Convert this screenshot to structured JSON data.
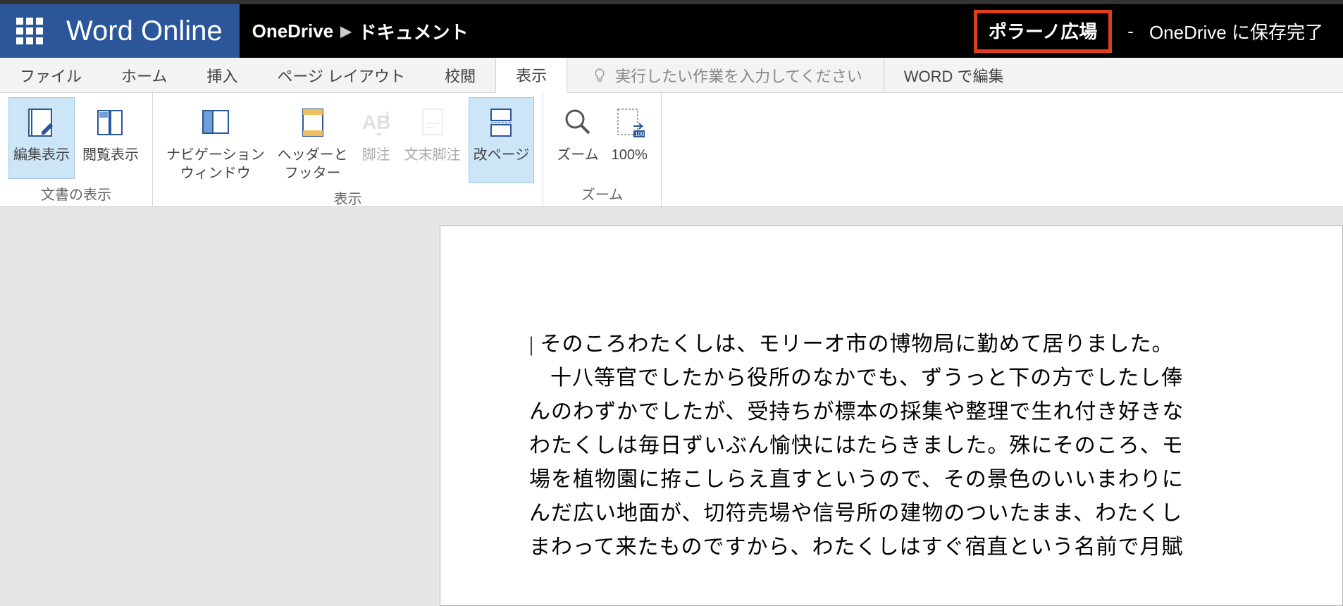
{
  "brand": {
    "title": "Word Online"
  },
  "breadcrumb": {
    "root": "OneDrive",
    "folder": "ドキュメント"
  },
  "document": {
    "name": "ポラーノ広場",
    "saved_status": "OneDrive に保存完了",
    "dash": "-"
  },
  "tabs": {
    "file": "ファイル",
    "home": "ホーム",
    "insert": "挿入",
    "layout": "ページ レイアウト",
    "review": "校閲",
    "view": "表示"
  },
  "tell_me": {
    "placeholder": "実行したい作業を入力してください"
  },
  "edit_in_word": "WORD で編集",
  "ribbon": {
    "edit_view": "編集表示",
    "reading_view": "閲覧表示",
    "nav_pane": "ナビゲーション\nウィンドウ",
    "header_footer": "ヘッダーと\nフッター",
    "footnotes": "脚注",
    "endnotes": "文末脚注",
    "page_breaks": "改ページ",
    "zoom": "ズーム",
    "zoom100": "100%",
    "group_views": "文書の表示",
    "group_show": "表示",
    "group_zoom": "ズーム"
  },
  "body": {
    "line1": " そのころわたくしは、モリーオ市の博物局に勤めて居りました。",
    "line2": "十八等官でしたから役所のなかでも、ずうっと下の方でしたし俸",
    "line3": "んのわずかでしたが、受持ちが標本の採集や整理で生れ付き好きな",
    "line4": "わたくしは毎日ずいぶん愉快にはたらきました。殊にそのころ、モ",
    "line5": "場を植物園に拵こしらえ直すというので、その景色のいいまわりに",
    "line6": "んだ広い地面が、切符売場や信号所の建物のついたまま、わたくし",
    "line7": "まわって来たものですから、わたくしはすぐ宿直という名前で月賦"
  }
}
